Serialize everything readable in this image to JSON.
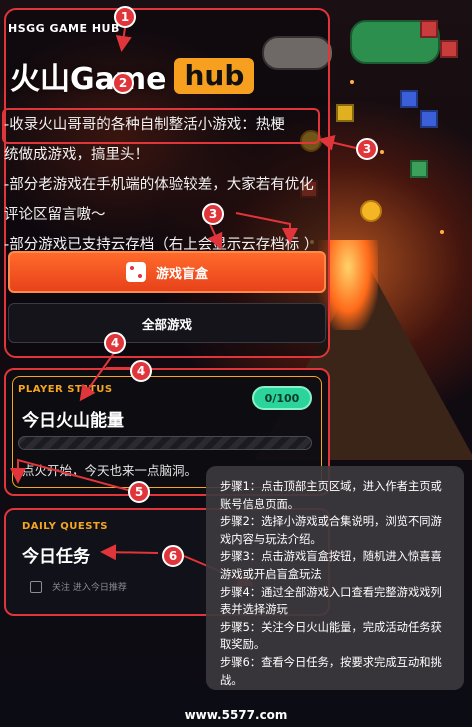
{
  "header": {
    "brand": "HSGG GAME HUB",
    "title_main": "火山Game",
    "title_badge": "hub"
  },
  "intro": {
    "lines": [
      "-收录火山哥哥的各种自制整活小游戏：热梗",
      "统做成游戏，搞里头！",
      "-部分老游戏在手机端的体验较差，大家若有优化",
      "评论区留言嗷～",
      "-部分游戏已支持云存档（右上会显示云存档标  ）"
    ]
  },
  "buttons": {
    "blind_box": "游戏盲盒",
    "all_games": "全部游戏"
  },
  "player_status": {
    "label": "PLAYER STATUS",
    "title": "今日火山能量",
    "progress_text": "0/100",
    "progress_value": 0,
    "progress_max": 100,
    "message": "点火开始，今天也来一点脑洞。"
  },
  "daily_quests": {
    "label": "DAILY QUESTS",
    "title": "今日任务",
    "item_text": "关注    进入今日推荐"
  },
  "markers": [
    "1",
    "2",
    "3",
    "3",
    "4",
    "4",
    "5",
    "6"
  ],
  "steps": [
    "步骤1：点击顶部主页区域，进入作者主页或账号信息页面。",
    "步骤2：选择小游戏或合集说明，浏览不同游戏内容与玩法介绍。",
    "步骤3：点击游戏盲盒按钮，随机进入惊喜喜游戏或开启盲盒玩法",
    "步骤4：通过全部游戏入口查看完整游戏戏列表并选择游玩",
    "步骤5：关注今日火山能量，完成活动任务获取奖励。",
    "步骤6：查看今日任务，按要求完成互动和挑战。"
  ],
  "footer": "www.5577.com",
  "colors": {
    "accent_red": "#e0353a",
    "accent_orange": "#ff6a2a",
    "badge_yellow": "#f7a01f",
    "status_green": "#2bd49a"
  }
}
